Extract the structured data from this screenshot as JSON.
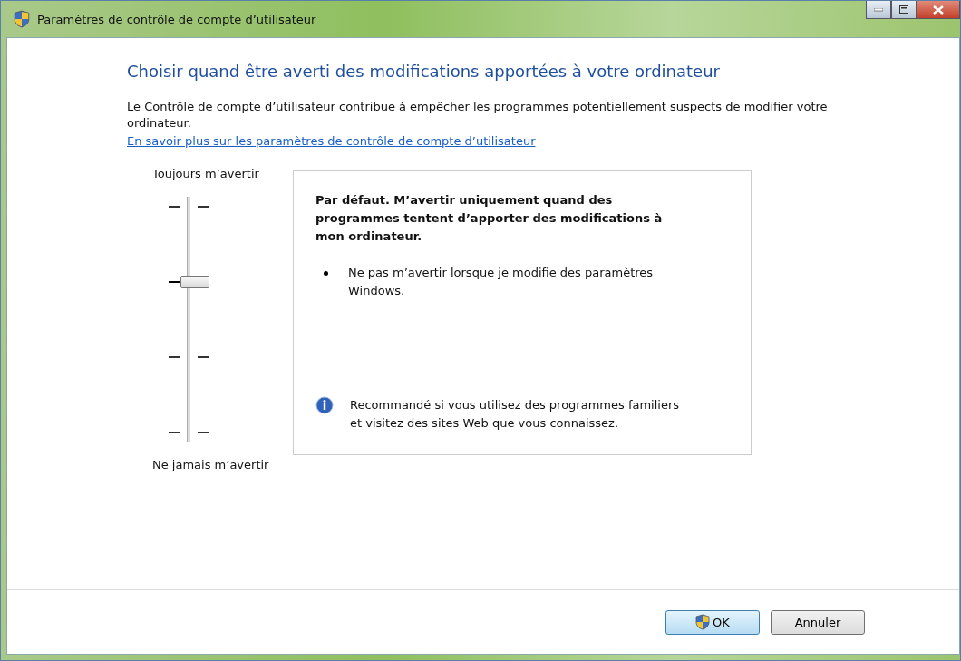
{
  "window": {
    "title": "Paramètres de contrôle de compte d’utilisateur"
  },
  "heading": "Choisir quand être averti des modifications apportées à votre ordinateur",
  "description": "Le Contrôle de compte d’utilisateur contribue à empêcher les programmes potentiellement suspects de modifier votre ordinateur.",
  "link": "En savoir plus sur les paramètres de contrôle de compte d’utilisateur",
  "slider": {
    "top_label": "Toujours m’avertir",
    "bottom_label": "Ne jamais m’avertir",
    "level": 0.667
  },
  "info_panel": {
    "title": "Par défaut. M’avertir uniquement quand des programmes tentent d’apporter des modifications à mon ordinateur.",
    "bullets": [
      "Ne pas m’avertir lorsque je modifie des paramètres Windows."
    ],
    "note": "Recommandé si vous utilisez des programmes familiers et visitez des sites Web que vous connaissez."
  },
  "buttons": [
    {
      "label": "OK",
      "kind": "shield",
      "default": true
    },
    {
      "label": "Annuler",
      "kind": "plain",
      "default": false
    }
  ]
}
